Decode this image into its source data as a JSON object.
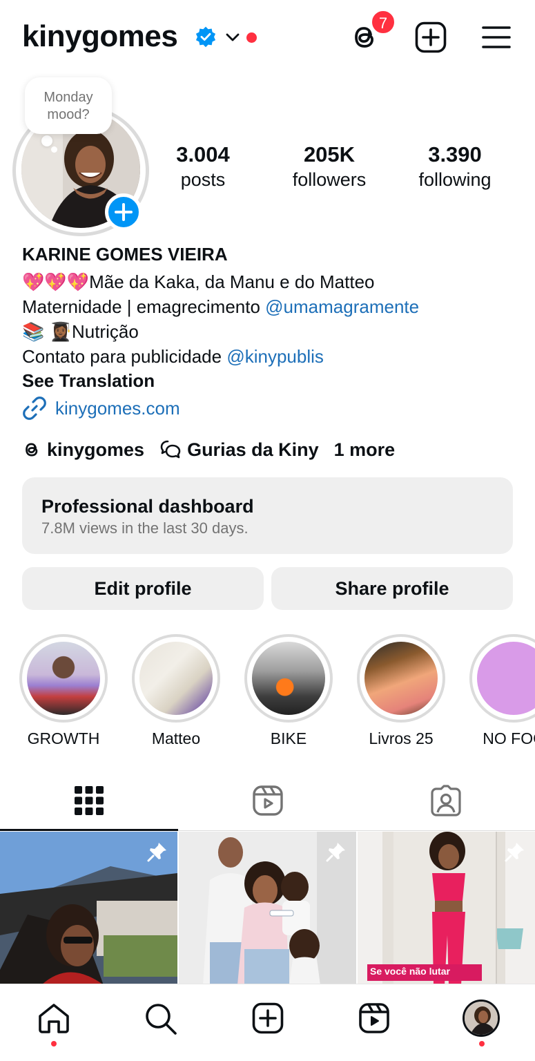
{
  "header": {
    "username": "kinygomes",
    "notification_count": "7"
  },
  "profile": {
    "note": "Monday mood?",
    "stats": [
      {
        "value": "3.004",
        "label": "posts"
      },
      {
        "value": "205K",
        "label": "followers"
      },
      {
        "value": "3.390",
        "label": "following"
      }
    ],
    "name": "KARINE GOMES VIEIRA",
    "bio": {
      "line1": "💖💖💖Mãe da Kaka, da Manu e do Matteo",
      "line2_text": "Maternidade | emagrecimento ",
      "line2_mention": "@umamagramente",
      "line3": "📚 👩🏾‍🎓Nutrição",
      "line4_text": "Contato para publicidade ",
      "line4_mention": "@kinypublis",
      "translation": "See Translation",
      "website": "kinygomes.com"
    },
    "chips": {
      "threads": "kinygomes",
      "channel": "Gurias da Kiny",
      "more": "1 more"
    }
  },
  "dashboard": {
    "title": "Professional dashboard",
    "subtitle": "7.8M views in the last 30 days."
  },
  "buttons": {
    "edit": "Edit profile",
    "share": "Share profile"
  },
  "highlights": [
    {
      "label": "GROWTH"
    },
    {
      "label": "Matteo"
    },
    {
      "label": "BIKE"
    },
    {
      "label": "Livros 25"
    },
    {
      "label": "NO FOC"
    }
  ],
  "posts": [
    {
      "caption": ""
    },
    {
      "caption": ""
    },
    {
      "caption": "Se você não lutar"
    }
  ],
  "colors": {
    "accent": "#0095f6",
    "notification": "#ff3040",
    "link": "#00376b"
  }
}
